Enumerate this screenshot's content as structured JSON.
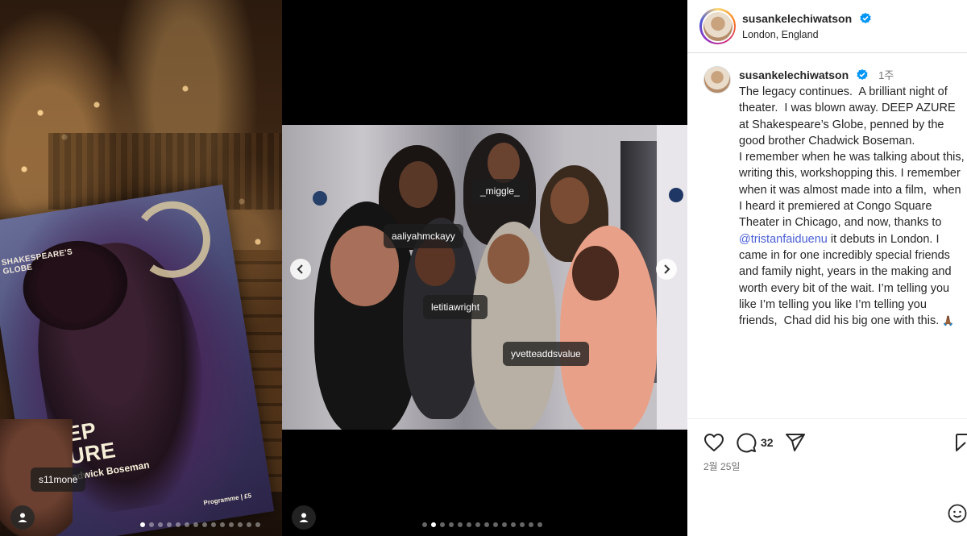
{
  "left_media": {
    "programme": {
      "publisher": "SHAKESPEARE'S GLOBE",
      "title": "DEEP AZURE",
      "byline": "By Chadwick Boseman",
      "footer": "Programme | £5"
    },
    "tag": "s11mone",
    "carousel": {
      "total": 14,
      "active": 0
    }
  },
  "mid_media": {
    "tags": [
      "_miggle_",
      "aaliyahmckayy",
      "letitiawright",
      "yvetteaddsvalue"
    ],
    "carousel": {
      "total": 14,
      "active": 1
    }
  },
  "post": {
    "header": {
      "username": "susankelechiwatson",
      "location": "London, England"
    },
    "caption": {
      "username": "susankelechiwatson",
      "time_ago": "1주",
      "text_before": "The legacy continues.  A brilliant night of theater.  I was blown away. DEEP AZURE at Shakespeare’s Globe, penned by the good brother Chadwick Boseman.\nI remember when he was talking about this, writing this, workshopping this. I remember when it was almost made into a film,  when I heard it premiered at Congo Square Theater in Chicago, and now, thanks to ",
      "mention": "@tristanfaiduenu",
      "text_after": " it debuts in London. I came in for one incredibly special friends and family night, years in the making and worth every bit of the wait. I’m telling you like I’m telling you like I’m telling you friends,  Chad did his big one with this. ",
      "emoji": "🙏🏾"
    },
    "actions": {
      "comment_count": "32"
    },
    "date": "2월 25일"
  },
  "colors": {
    "verified": "#0095f6",
    "mention": "#4a5fd6",
    "text": "#262626",
    "muted": "#737373"
  },
  "icons": [
    "user-tag-icon",
    "chevron-left-icon",
    "chevron-right-icon",
    "heart-icon",
    "comment-icon",
    "share-icon",
    "bookmark-icon",
    "emoji-icon",
    "verified-badge-icon"
  ]
}
